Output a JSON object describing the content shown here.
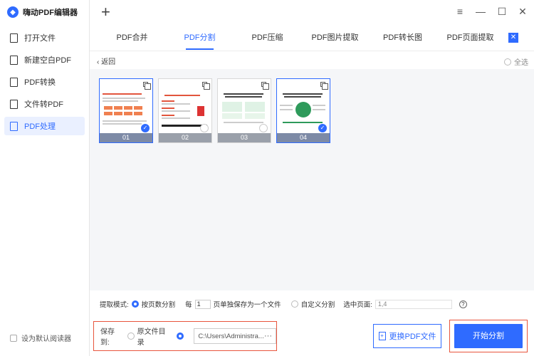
{
  "app": {
    "name": "嗨动PDF编辑器"
  },
  "sidebar": {
    "items": [
      {
        "label": "打开文件",
        "icon": "file-open-icon"
      },
      {
        "label": "新建空白PDF",
        "icon": "new-pdf-icon"
      },
      {
        "label": "PDF转换",
        "icon": "pdf-convert-icon"
      },
      {
        "label": "文件转PDF",
        "icon": "file-to-pdf-icon"
      },
      {
        "label": "PDF处理",
        "icon": "pdf-process-icon"
      }
    ],
    "default_reader_label": "设为默认阅读器"
  },
  "window": {
    "add": "+",
    "menu": "≡",
    "minimize": "—",
    "maximize": "☐",
    "close": "✕"
  },
  "tabs": [
    {
      "label": "PDF合并"
    },
    {
      "label": "PDF分割"
    },
    {
      "label": "PDF压缩"
    },
    {
      "label": "PDF图片提取"
    },
    {
      "label": "PDF转长图"
    },
    {
      "label": "PDF页面提取"
    }
  ],
  "content": {
    "back_label": "返回",
    "select_all_label": "全选",
    "pages": [
      {
        "number": "01",
        "selected": true
      },
      {
        "number": "02",
        "selected": false
      },
      {
        "number": "03",
        "selected": false
      },
      {
        "number": "04",
        "selected": true
      }
    ]
  },
  "options": {
    "mode_label": "提取模式:",
    "by_page_label": "按页数分割",
    "every_label": "每",
    "every_value": "1",
    "per_file_label": "页单独保存为一个文件",
    "custom_label": "自定义分割",
    "selected_pages_label": "选中页面:",
    "selected_pages_value": "1,4",
    "help": "?"
  },
  "save": {
    "save_to_label": "保存到:",
    "original_dir_label": "原文件目录",
    "path_value": "C:\\Users\\Administra...",
    "path_more": "···"
  },
  "buttons": {
    "replace_label": "更换PDF文件",
    "start_label": "开始分割"
  },
  "colors": {
    "accent": "#2f6bff",
    "highlight_border": "#e8553d"
  }
}
